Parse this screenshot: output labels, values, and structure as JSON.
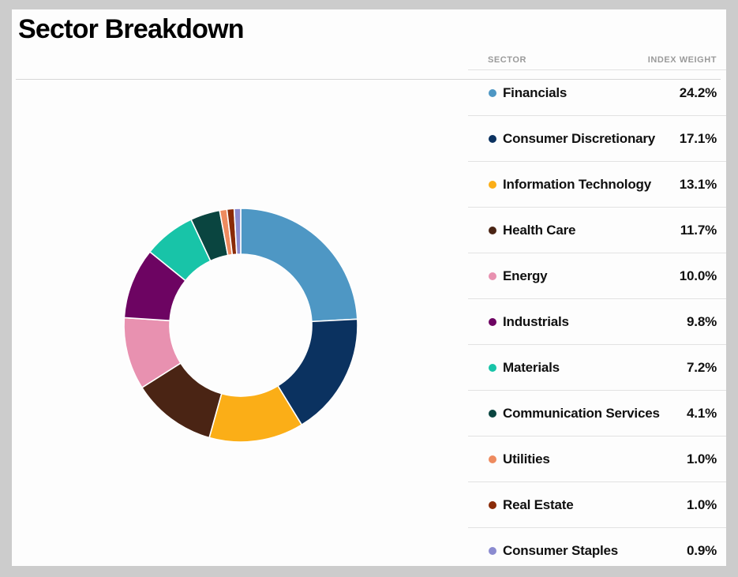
{
  "header": {
    "title": "Sector Breakdown"
  },
  "table": {
    "columns": {
      "sector": "SECTOR",
      "weight": "INDEX WEIGHT"
    }
  },
  "chart_data": {
    "type": "pie",
    "variant": "donut",
    "title": "Sector Breakdown",
    "xlabel": "",
    "ylabel": "",
    "legend_position": "right",
    "grid": false,
    "start_angle_deg": 0,
    "direction": "clockwise",
    "units": "percent",
    "categories": [
      "Financials",
      "Consumer Discretionary",
      "Information Technology",
      "Health Care",
      "Energy",
      "Industrials",
      "Materials",
      "Communication Services",
      "Utilities",
      "Real Estate",
      "Consumer Staples"
    ],
    "values": [
      24.2,
      17.1,
      13.1,
      11.7,
      10.0,
      9.8,
      7.2,
      4.1,
      1.0,
      1.0,
      0.9
    ],
    "labels": [
      "24.2%",
      "17.1%",
      "13.1%",
      "11.7%",
      "10.0%",
      "9.8%",
      "7.2%",
      "4.1%",
      "1.0%",
      "1.0%",
      "0.9%"
    ],
    "colors": [
      "#4e97c4",
      "#0b3260",
      "#fbae17",
      "#4a2414",
      "#e891b0",
      "#6d0462",
      "#18c4a8",
      "#0a4540",
      "#ee8b5f",
      "#8a2b08",
      "#8b8bd0"
    ]
  },
  "rows": [
    {
      "label": "Financials",
      "weight": "24.2%",
      "color": "#4e97c4"
    },
    {
      "label": "Consumer Discretionary",
      "weight": "17.1%",
      "color": "#0b3260"
    },
    {
      "label": "Information Technology",
      "weight": "13.1%",
      "color": "#fbae17"
    },
    {
      "label": "Health Care",
      "weight": "11.7%",
      "color": "#4a2414"
    },
    {
      "label": "Energy",
      "weight": "10.0%",
      "color": "#e891b0"
    },
    {
      "label": "Industrials",
      "weight": "9.8%",
      "color": "#6d0462"
    },
    {
      "label": "Materials",
      "weight": "7.2%",
      "color": "#18c4a8"
    },
    {
      "label": "Communication Services",
      "weight": "4.1%",
      "color": "#0a4540"
    },
    {
      "label": "Utilities",
      "weight": "1.0%",
      "color": "#ee8b5f"
    },
    {
      "label": "Real Estate",
      "weight": "1.0%",
      "color": "#8a2b08"
    },
    {
      "label": "Consumer Staples",
      "weight": "0.9%",
      "color": "#8b8bd0"
    }
  ],
  "theme": {
    "page_background": "#cccccc",
    "card_background": "#fdfdfd",
    "divider": "#e2e2e2",
    "header_text": "#9a9a9a",
    "body_text": "#101010"
  }
}
